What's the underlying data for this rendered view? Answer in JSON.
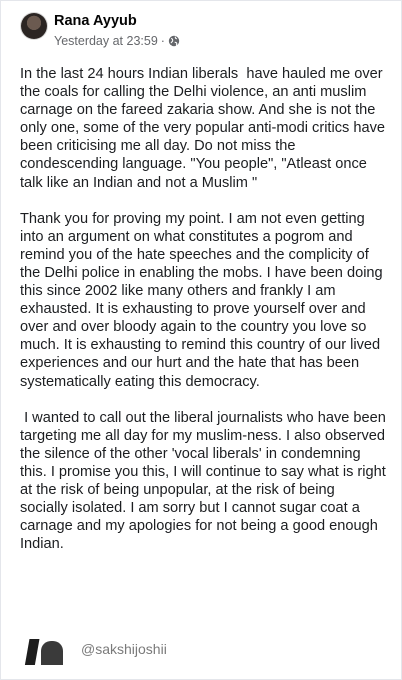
{
  "post": {
    "author": "Rana Ayyub",
    "timestamp": "Yesterday at 23:59",
    "separator": "·",
    "privacy_icon": "globe-icon",
    "paragraphs": [
      "In the last 24 hours Indian liberals  have hauled me over the coals for calling the Delhi violence, an anti muslim carnage on the fareed zakaria show. And she is not the only one, some of the very popular anti-modi critics have been criticising me all day. Do not miss the condescending language. \"You people\", \"Atleast once talk like an Indian and not a Muslim \"",
      "Thank you for proving my point. I am not even getting into an argument on what constitutes a pogrom and remind you of the hate speeches and the complicity of the Delhi police in enabling the mobs. I have been doing this since 2002 like many others and frankly I am exhausted. It is exhausting to prove yourself over and over and over bloody again to the country you love so much. It is exhausting to remind this country of our lived experiences and our hurt and the hate that has been systematically eating this democracy.",
      " I wanted to call out the liberal journalists who have been targeting me all day for my muslim-ness. I also observed the silence of the other 'vocal liberals' in condemning this. I promise you this, I will continue to say what is right at the risk of being unpopular, at the risk of being socially isolated. I am sorry but I cannot sugar coat a carnage and my apologies for not being a good enough Indian."
    ]
  },
  "watermark": {
    "handle": "@sakshijoshii"
  },
  "colors": {
    "text": "#1c1e21",
    "meta": "#65676b",
    "handle": "#7a7a7a"
  }
}
